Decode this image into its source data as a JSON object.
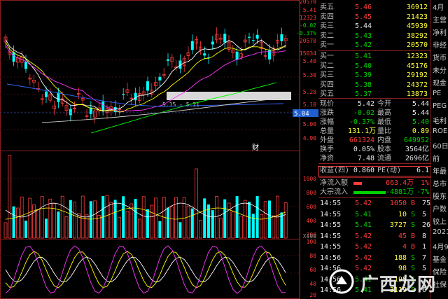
{
  "price_axis": {
    "labels": [
      "20570",
      "5.41",
      "12323",
      "-0.02",
      "-0.37%",
      "20570",
      "15034",
      "5.40",
      "5.30",
      "5.20",
      "5.10",
      "5.04",
      "5.00",
      "4.90"
    ]
  },
  "volume_axis": {
    "labels": [
      "1000",
      "800",
      "600",
      "400",
      "200",
      "X100"
    ]
  },
  "indicator_axis": {
    "labels": [
      "100",
      "80",
      "60",
      "40",
      "20"
    ]
  },
  "chart": {
    "range_label": "5.15 - 5.21",
    "current_price_tag": "5.04",
    "event_marker": "财",
    "colors": {
      "up": "#ff3b3b",
      "down": "#00ffff",
      "ma5": "#ffffff",
      "ma10": "#ffff00",
      "ma20": "#ff37ff",
      "ma60": "#00ff00",
      "ma120": "#3366ff",
      "band": "#d8d8d8"
    }
  },
  "order_book": {
    "header_partial": "卖五",
    "asks": [
      {
        "label": "卖五",
        "price": "5.46",
        "vol": "36912"
      },
      {
        "label": "卖四",
        "price": "5.45",
        "vol": "21423"
      },
      {
        "label": "卖三",
        "price": "5.44",
        "vol": "45939"
      },
      {
        "label": "卖二",
        "price": "5.43",
        "vol": "38292"
      },
      {
        "label": "卖一",
        "price": "5.42",
        "vol": "20570"
      }
    ],
    "bids": [
      {
        "label": "买一",
        "price": "5.41",
        "vol": "12323"
      },
      {
        "label": "买二",
        "price": "5.40",
        "vol": "45176"
      },
      {
        "label": "买三",
        "price": "5.39",
        "vol": "29192"
      },
      {
        "label": "买四",
        "price": "5.38",
        "vol": "24372"
      },
      {
        "label": "买五",
        "price": "5.37",
        "vol": "13873"
      }
    ]
  },
  "quote": {
    "rows": [
      {
        "l1": "现价",
        "v1": "5.42",
        "l2": "今开",
        "v2": "5.44"
      },
      {
        "l1": "涨跌",
        "v1": "-0.02",
        "l2": "最高",
        "v2": "5.44"
      },
      {
        "l1": "涨幅",
        "v1": "-0.37%",
        "l2": "最低",
        "v2": "5.40"
      },
      {
        "l1": "总量",
        "v1": "131.1万",
        "l2": "量比",
        "v2": "0.89"
      },
      {
        "l1": "外盘",
        "v1": "661324",
        "l2": "内盘",
        "v2": "649952"
      },
      {
        "l1": "换手",
        "v1": "0.05%",
        "l2": "股本",
        "v2": "3564亿"
      },
      {
        "l1": "净资",
        "v1": "7.48",
        "l2": "流通",
        "v2": "2696亿"
      }
    ],
    "earnings": {
      "l1": "收益(四)",
      "v1": "0.860",
      "l2": "PE(动)",
      "v2": "6.1"
    }
  },
  "fund_flow": [
    {
      "label": "净流入额",
      "value": "663.4万",
      "pct": "1%"
    },
    {
      "label": "大宗流入",
      "value": "-4881万",
      "pct": "-7%"
    }
  ],
  "ticks": [
    {
      "time": "14:55",
      "price": "5.42",
      "vol": "1050",
      "side": "B",
      "extra": "75"
    },
    {
      "time": "14:55",
      "price": "5.41",
      "vol": "10",
      "side": "S",
      "extra": "5"
    },
    {
      "time": "14:55",
      "price": "5.41",
      "vol": "3727",
      "side": "S",
      "extra": "26"
    },
    {
      "time": "14:55",
      "price": "5.42",
      "vol": "45",
      "side": "B",
      "extra": "8"
    },
    {
      "time": "14:55",
      "price": "5.42",
      "vol": "4",
      "side": "B",
      "extra": "1"
    },
    {
      "time": "14:56",
      "price": "5.42",
      "vol": "188",
      "side": "S",
      "extra": "7"
    },
    {
      "time": "14:56",
      "price": "5.42",
      "vol": "98",
      "side": "S",
      "extra": "5"
    },
    {
      "time": "14:56",
      "price": "5.41",
      "vol": "195",
      "side": "S",
      "extra": "7"
    },
    {
      "time": "14:56",
      "price": "5.41",
      "vol": "3119",
      "side": "S",
      "extra": "6"
    }
  ],
  "edge_panel": {
    "labels": [
      "4月",
      "主营",
      "净利",
      "非经",
      "货币",
      "未分",
      "现金",
      "PE",
      "PEG",
      "毛利",
      "ROE",
      "60日",
      "前",
      "年最",
      "总市",
      "股东",
      "户数",
      "较上",
      "2021",
      "4月9",
      "基金",
      "保险",
      "社保"
    ]
  },
  "watermark": {
    "text": "广西龙网"
  }
}
